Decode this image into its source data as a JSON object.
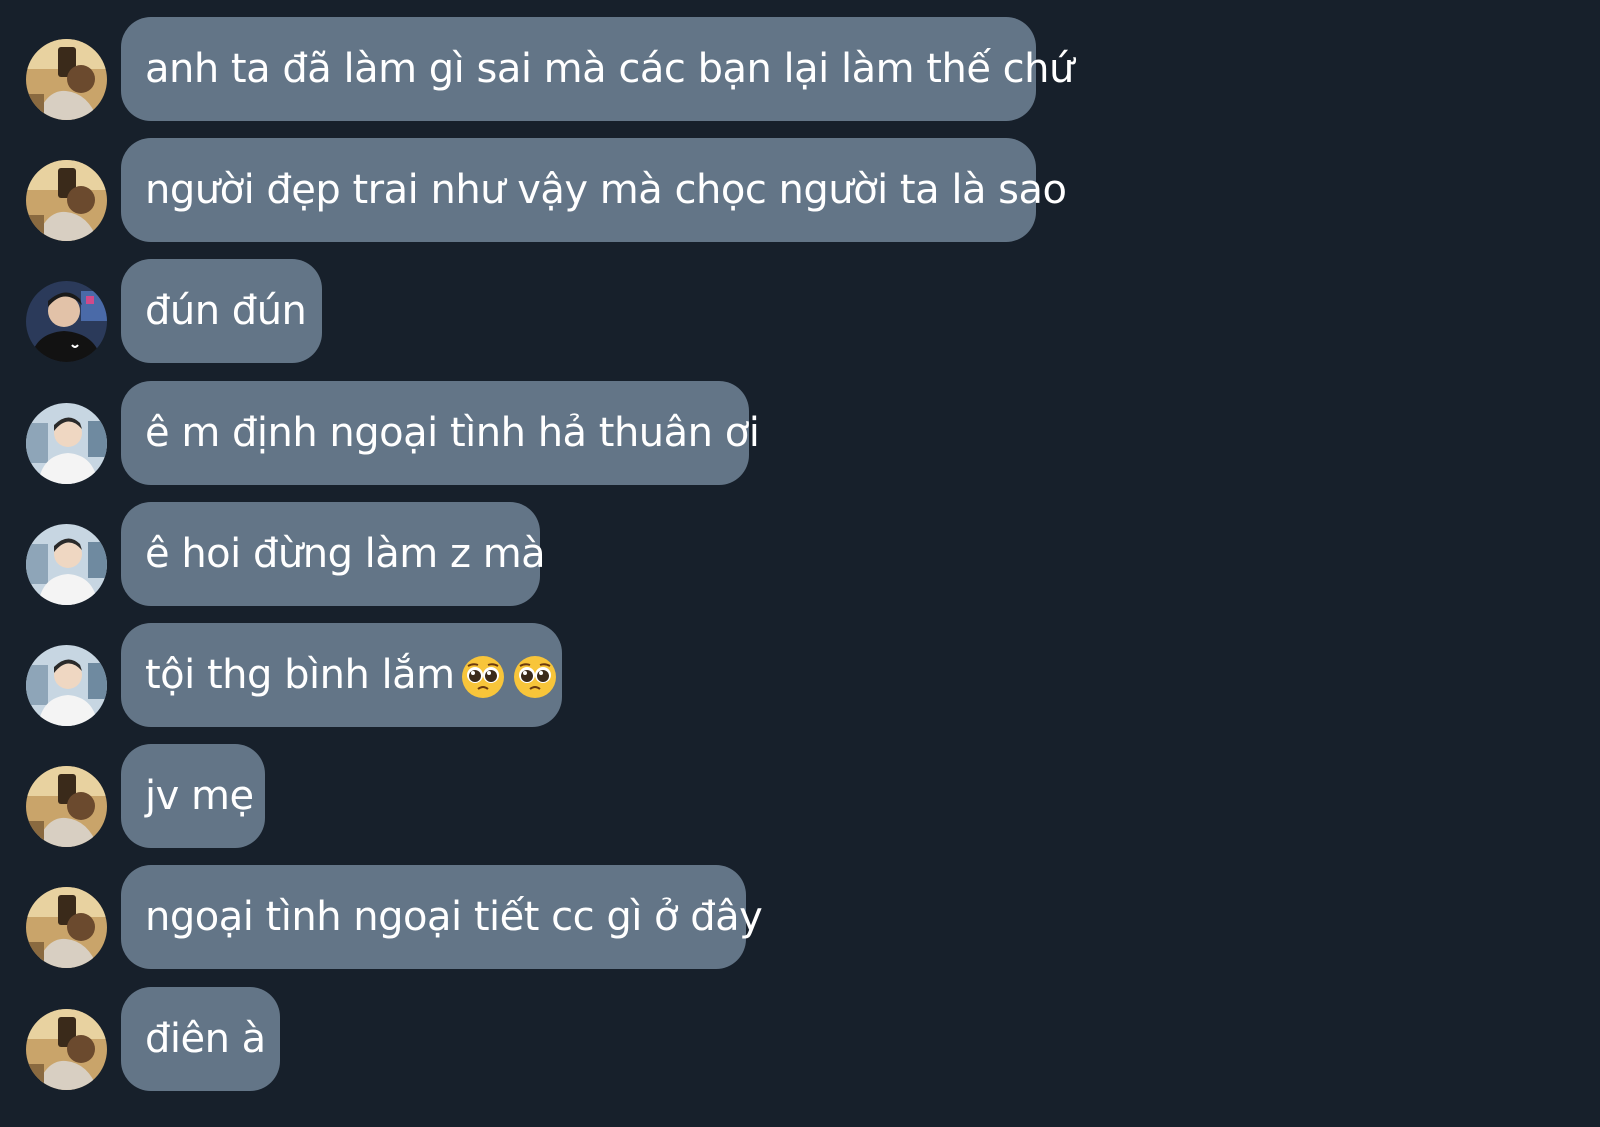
{
  "messages": [
    {
      "text": "anh ta đã làm gì sai mà các bạn lại làm thế chứ",
      "avatar": "avatar-girl-mirror-selfie"
    },
    {
      "text": "người đẹp trai như vậy mà chọc người ta là sao",
      "avatar": "avatar-girl-mirror-selfie"
    },
    {
      "text": "đún đún",
      "avatar": "avatar-boy-black-shirt"
    },
    {
      "text": "ê m định ngoại tình hả thuân ơi",
      "avatar": "avatar-boy-white-shirt"
    },
    {
      "text": "ê hoi đừng làm z mà",
      "avatar": "avatar-boy-white-shirt"
    },
    {
      "text": "tội thg bình lắm",
      "avatar": "avatar-boy-white-shirt",
      "emojis": [
        "pleading-face-emoji",
        "pleading-face-emoji"
      ]
    },
    {
      "text": "jv mẹ",
      "avatar": "avatar-girl-mirror-selfie"
    },
    {
      "text": "ngoại tình ngoại tiết cc gì ở đây",
      "avatar": "avatar-girl-mirror-selfie"
    },
    {
      "text": "điên à",
      "avatar": "avatar-girl-mirror-selfie"
    }
  ],
  "colors": {
    "background": "#17202b",
    "bubble": "#637587",
    "text": "#ffffff"
  }
}
